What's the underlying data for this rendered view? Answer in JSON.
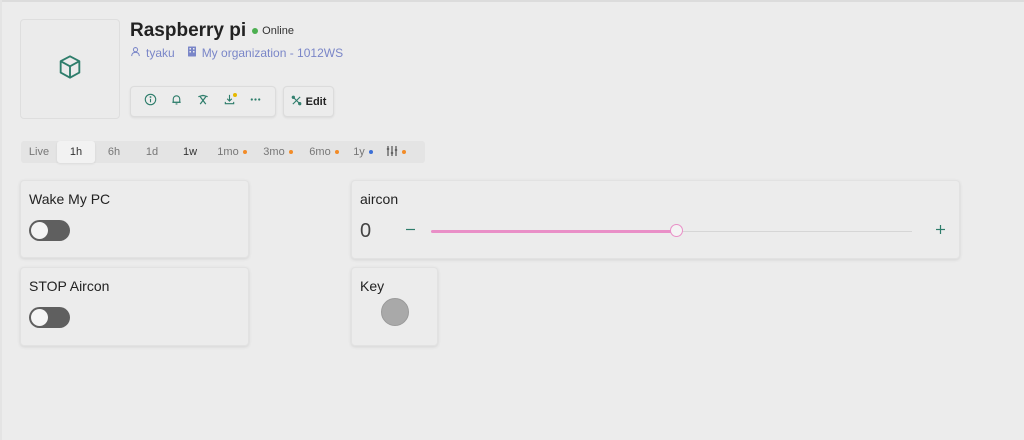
{
  "device": {
    "title": "Raspberry pi",
    "status": "Online",
    "owner": "tyaku",
    "organization": "My organization - 1012WS",
    "icon": "cube-icon"
  },
  "actions": {
    "icons": [
      "info-icon",
      "bell-icon",
      "tools-icon",
      "download-icon",
      "more-icon"
    ],
    "edit_label": "Edit"
  },
  "timebar": {
    "items": [
      "Live",
      "1h",
      "6h",
      "1d",
      "1w",
      "1mo",
      "3mo",
      "6mo",
      "1y"
    ],
    "active": "1h",
    "filter_icon": "sliders-icon"
  },
  "widgets": {
    "wake_pc": {
      "title": "Wake My PC",
      "on": false
    },
    "stop_aircon": {
      "title": "STOP Aircon",
      "on": false
    },
    "aircon": {
      "title": "aircon",
      "value": "0",
      "fill_fraction": 0.51
    },
    "key": {
      "title": "Key"
    }
  },
  "colors": {
    "accent_green": "#2e7d6b",
    "online": "#4caf50",
    "link": "#7a86c8",
    "slider": "#e98fc7",
    "dot_orange": "#f28c28",
    "dot_blue": "#3b6fd6"
  }
}
